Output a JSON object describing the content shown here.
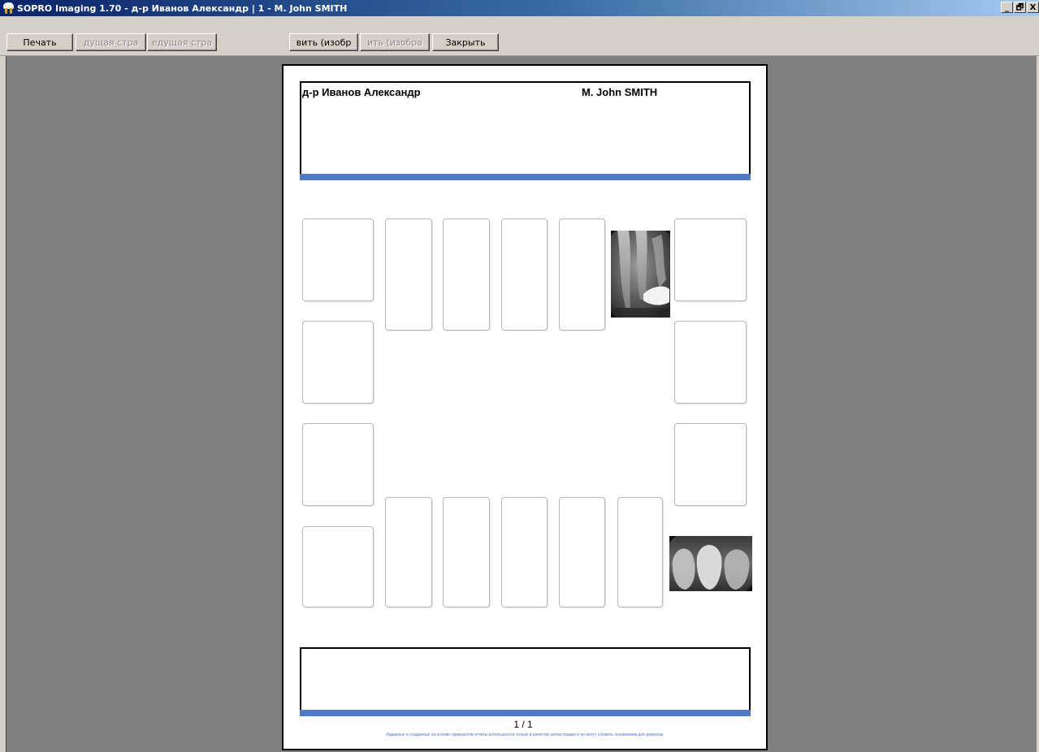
{
  "window": {
    "title": "SOPRO Imaging 1.70 - д-р Иванов Александр | 1 - M. John SMITH",
    "controls": [
      "_",
      "🗗",
      "X"
    ]
  },
  "toolbar": {
    "print": "Печать",
    "prev_page": "дущая стра",
    "next_page": "едущая стра",
    "add_image": "вить (изобр",
    "remove_image": "ить (изобра",
    "close": "Закрыть"
  },
  "report": {
    "doctor": "д-р Иванов Александр",
    "patient": "M. John SMITH",
    "page_number": "1 / 1",
    "disclaimer": "Изданные и созданные на основе скриншотов отчёты используются только в качестве иллюстрации и не могут служить основанием для диагноза."
  },
  "colors": {
    "accent_bar": "#4f7bc4",
    "workspace": "#808080",
    "titlebar_start": "#0a246a"
  },
  "icons": {
    "app": "tooth-icon"
  }
}
